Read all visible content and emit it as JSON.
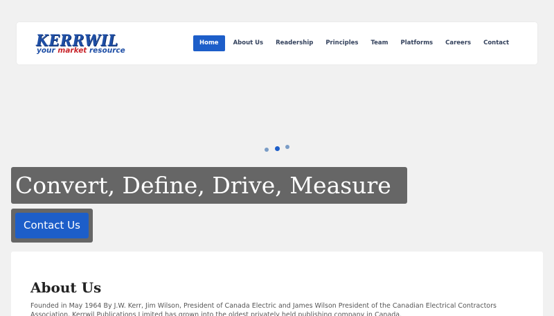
{
  "logo": {
    "wordmark": "KERRWIL",
    "tagline_prefix": "your ",
    "tagline_accent": "market",
    "tagline_suffix": " resource"
  },
  "nav": {
    "items": [
      {
        "label": "Home",
        "active": true
      },
      {
        "label": "About Us",
        "active": false
      },
      {
        "label": "Readership",
        "active": false
      },
      {
        "label": "Principles",
        "active": false
      },
      {
        "label": "Team",
        "active": false
      },
      {
        "label": "Platforms",
        "active": false
      },
      {
        "label": "Careers",
        "active": false
      },
      {
        "label": "Contact",
        "active": false
      }
    ]
  },
  "carousel": {
    "dots": 3,
    "active_index": 1,
    "colors": {
      "active": "#1d5ec9",
      "inactive": "#7a9cc6"
    }
  },
  "hero": {
    "title": "Convert, Define, Drive, Measure",
    "cta_label": "Contact Us"
  },
  "about": {
    "title": "About Us",
    "text": "Founded in May 1964 By J.W. Kerr, Jim Wilson, President of Canada Electric and James Wilson President of the Canadian Electrical Contractors Association, Kerrwil Publications Limited has grown into the oldest privately held publishing company in Canada."
  },
  "colors": {
    "accent": "#1d5ec9",
    "hero_bg": "#666666",
    "page_bg": "#f1f1f1",
    "logo_blue": "#1f4fa6",
    "logo_red": "#c8262c"
  }
}
